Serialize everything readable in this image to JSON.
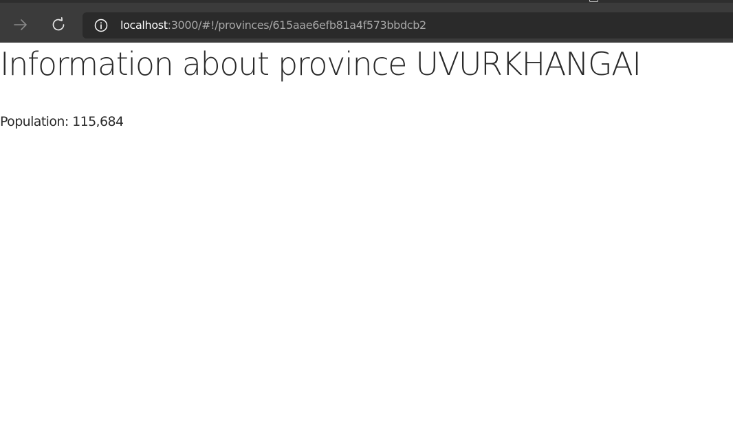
{
  "browser": {
    "address": {
      "host": "localhost",
      "path": ":3000/#!/provinces/615aae6efb81a4f573bbdcb2"
    },
    "icons": {
      "forward": "arrow-right-icon",
      "refresh": "refresh-icon",
      "site_info": "info-circle-icon"
    }
  },
  "page": {
    "title": "Information about province UVURKHANGAI",
    "population_label": "Population:",
    "population_value": "115,684"
  },
  "colors": {
    "toolbar_bg": "#3b3b3b",
    "address_bg": "#2a2a2a",
    "page_text": "#2a2a2a"
  }
}
